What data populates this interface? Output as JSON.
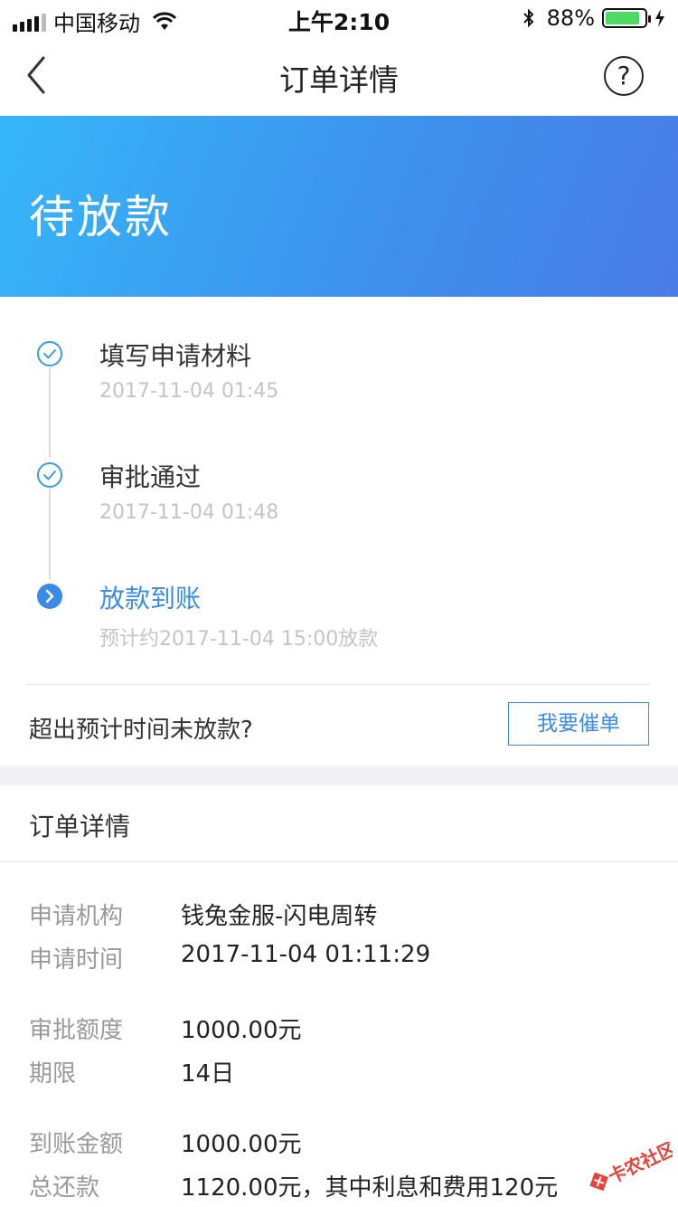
{
  "status_bar": {
    "carrier": "中国移动",
    "time": "上午2:10",
    "battery": "88%"
  },
  "nav": {
    "title": "订单详情",
    "help": "?"
  },
  "banner": {
    "status": "待放款",
    "gradient_colors": [
      "#36b6f9",
      "#4a7ce6"
    ]
  },
  "timeline": {
    "steps": [
      {
        "title": "填写申请材料",
        "time": "2017-11-04 01:45",
        "state": "done"
      },
      {
        "title": "审批通过",
        "time": "2017-11-04 01:48",
        "state": "done"
      },
      {
        "title": "放款到账",
        "time": "预计约2017-11-04 15:00放款",
        "state": "current"
      }
    ],
    "remind_text": "超出预计时间未放款?",
    "urge_button": "我要催单"
  },
  "details": {
    "header": "订单详情",
    "rows": [
      {
        "label": "申请机构",
        "value": "钱兔金服-闪电周转"
      },
      {
        "label": "申请时间",
        "value": "2017-11-04 01:11:29"
      },
      {
        "label": "审批额度",
        "value": "1000.00元"
      },
      {
        "label": "期限",
        "value": "14日"
      },
      {
        "label": "到账金额",
        "value": "1000.00元"
      },
      {
        "label": "总还款",
        "value": "1120.00元，其中利息和费用120元"
      }
    ]
  },
  "watermark": {
    "text": "卡农社区"
  },
  "colors": {
    "accent": "#3a8ae8",
    "check": "#3a9be8"
  }
}
